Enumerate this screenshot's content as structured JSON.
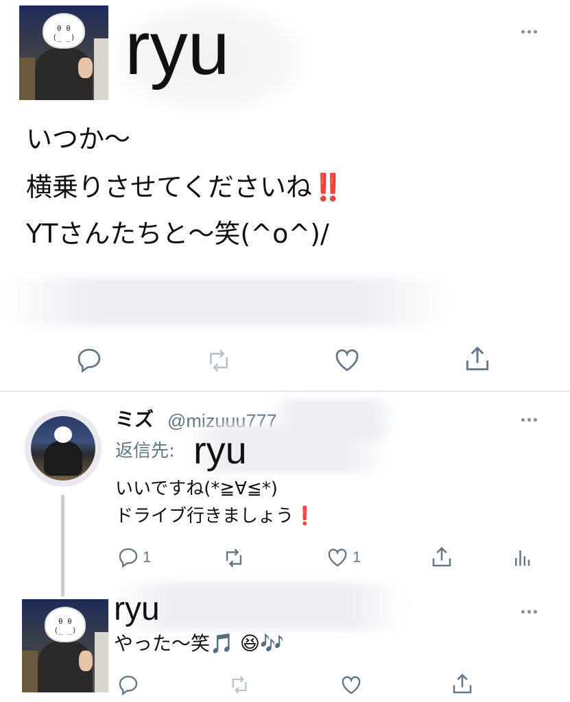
{
  "main_tweet": {
    "author_name": "ryu",
    "text_lines": [
      "いつか〜",
      "横乗りさせてくださいね‼️",
      "YTさんたちと〜笑(^o^)/"
    ],
    "actions": [
      {
        "icon": "reply-icon"
      },
      {
        "icon": "retweet-icon"
      },
      {
        "icon": "like-icon"
      },
      {
        "icon": "share-icon"
      }
    ]
  },
  "reply_tweet": {
    "author_name": "ミズ",
    "author_handle": "@mizuuu777",
    "reply_to_label": "返信先:",
    "reply_to_user": "ryu",
    "text_lines": [
      "いいですね(*≧∀≦*)",
      "ドライブ行きましょう❗️"
    ],
    "reply_count": "1",
    "like_count": "1",
    "actions": [
      {
        "icon": "reply-icon"
      },
      {
        "icon": "retweet-icon"
      },
      {
        "icon": "like-icon"
      },
      {
        "icon": "share-icon"
      },
      {
        "icon": "analytics-icon"
      }
    ]
  },
  "nested_reply": {
    "author_name": "ryu",
    "text": "やった〜笑🎵 😆🎶"
  },
  "colors": {
    "icon_gray": "#657786",
    "retweet_disabled": "#b8c2cc",
    "thread_line": "#c4cfd6",
    "red_exclamation": "#e0243b"
  }
}
